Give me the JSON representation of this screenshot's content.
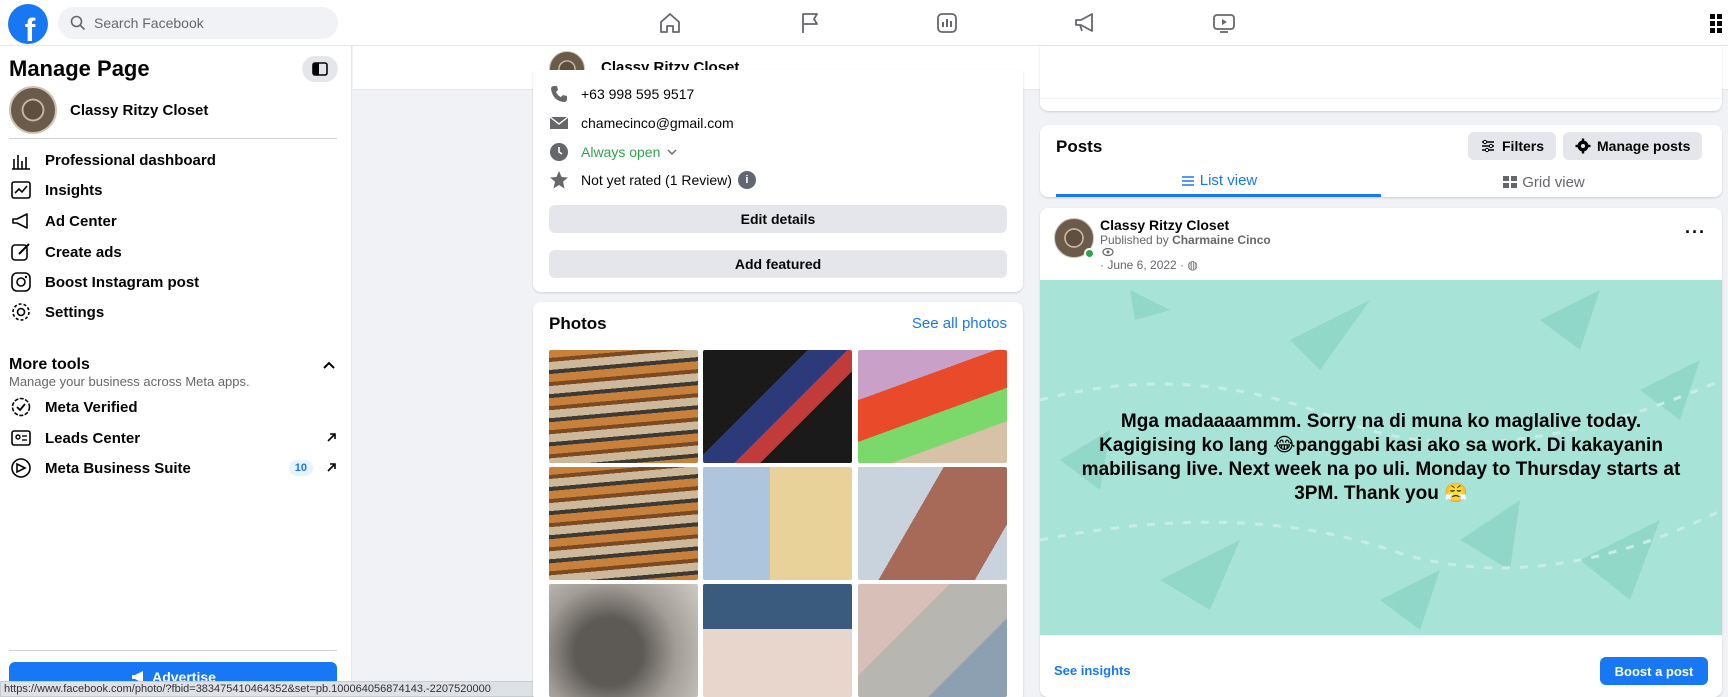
{
  "topbar": {
    "logo": "f",
    "search_placeholder": "Search Facebook",
    "nav_icons": [
      "home-icon",
      "flag-icon",
      "insights-icon",
      "megaphone-icon",
      "video-icon"
    ]
  },
  "sidebar": {
    "title": "Manage Page",
    "page_name": "Classy Ritzy Closet",
    "items": [
      {
        "label": "Professional dashboard",
        "icon": "dashboard-icon"
      },
      {
        "label": "Insights",
        "icon": "insights-icon"
      },
      {
        "label": "Ad Center",
        "icon": "megaphone-icon"
      },
      {
        "label": "Create ads",
        "icon": "pencil-icon"
      },
      {
        "label": "Boost Instagram post",
        "icon": "instagram-icon"
      },
      {
        "label": "Settings",
        "icon": "gear-icon"
      }
    ],
    "more_tools": "More tools",
    "more_tools_sub": "Manage your business across Meta apps.",
    "tools": [
      {
        "label": "Meta Verified",
        "icon": "verified-icon"
      },
      {
        "label": "Leads Center",
        "icon": "leads-icon"
      },
      {
        "label": "Meta Business Suite",
        "icon": "business-suite-icon",
        "badge": "10"
      }
    ],
    "advertise": "Advertise"
  },
  "status_url": "https://www.facebook.com/photo/?fbid=383475410464352&set=pb.100064056874143.-2207520000",
  "page_header": {
    "name": "Classy Ritzy Closet",
    "more": "···"
  },
  "intro": {
    "phone": "+63 998 595 9517",
    "email": "chamecinco@gmail.com",
    "hours": "Always open",
    "rating": "Not yet rated (1 Review)",
    "rating_badge": "i",
    "edit_details": "Edit details",
    "add_featured": "Add featured"
  },
  "photos": {
    "title": "Photos",
    "see_all": "See all photos"
  },
  "posts": {
    "title": "Posts",
    "filters": "Filters",
    "manage": "Manage posts",
    "tab_list": "List view",
    "tab_grid": "Grid view"
  },
  "post": {
    "page_name": "Classy Ritzy Closet",
    "published_prefix": "Published by",
    "published_by": "Charmaine Cinco",
    "date": "· June 6, 2022 ·",
    "more": "···",
    "text": "Mga madaaaammm. Sorry na di muna ko maglalive today. Kagigising ko lang 😂panggabi kasi ako sa work. Di kakayanin mabilisang live. Next week na po uli. Monday to Thursday starts at 3PM. Thank you 😤",
    "see_insights": "See insights",
    "boost": "Boost a post"
  },
  "colors": {
    "brand": "#1877f2",
    "post_background": "#a8e3d8",
    "open_green": "#31a24c"
  }
}
